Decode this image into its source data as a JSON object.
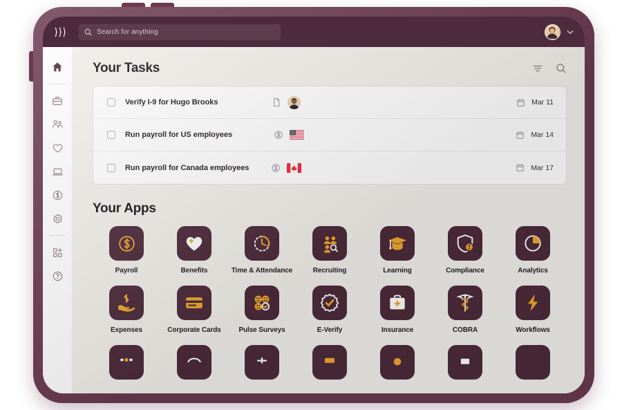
{
  "topbar": {
    "logo_icon": "rippling-wave-logo",
    "search": {
      "icon": "search-icon",
      "placeholder": "Search for anything",
      "value": ""
    },
    "avatar_icon": "user-avatar",
    "chevron_icon": "chevron-down-icon"
  },
  "sidebar": {
    "items": [
      {
        "name": "home",
        "icon": "home-icon",
        "active": true
      },
      {
        "name": "work",
        "icon": "briefcase-icon",
        "active": false
      },
      {
        "name": "people",
        "icon": "people-icon",
        "active": false
      },
      {
        "name": "benefits",
        "icon": "heart-icon",
        "active": false
      },
      {
        "name": "devices",
        "icon": "laptop-icon",
        "active": false
      },
      {
        "name": "finance",
        "icon": "dollar-circle-icon",
        "active": false
      },
      {
        "name": "settings",
        "icon": "gear-icon",
        "active": false
      },
      {
        "name": "add-apps",
        "icon": "add-apps-icon",
        "active": false
      },
      {
        "name": "help",
        "icon": "help-circle-icon",
        "active": false
      }
    ]
  },
  "tasks_section": {
    "title": "Your Tasks",
    "filter_icon": "filter-icon",
    "search_icon": "search-icon",
    "rows": [
      {
        "checked": false,
        "label": "Verify I-9 for Hugo Brooks",
        "type_icon": "document-icon",
        "subject_icon": "person-avatar",
        "date_icon": "calendar-icon",
        "date": "Mar 11"
      },
      {
        "checked": false,
        "label": "Run payroll for US employees",
        "type_icon": "dollar-circle-icon",
        "subject_icon": "flag-us",
        "date_icon": "calendar-icon",
        "date": "Mar 14"
      },
      {
        "checked": false,
        "label": "Run payroll for Canada employees",
        "type_icon": "dollar-circle-icon",
        "subject_icon": "flag-ca",
        "date_icon": "calendar-icon",
        "date": "Mar 17"
      }
    ]
  },
  "apps_section": {
    "title": "Your Apps",
    "apps": [
      {
        "label": "Payroll",
        "icon": "dollar-circle-icon"
      },
      {
        "label": "Benefits",
        "icon": "heart-plus-icon"
      },
      {
        "label": "Time & Attendance",
        "icon": "clock-icon"
      },
      {
        "label": "Recruiting",
        "icon": "people-search-icon"
      },
      {
        "label": "Learning",
        "icon": "graduation-cap-icon"
      },
      {
        "label": "Compliance",
        "icon": "shield-alert-icon"
      },
      {
        "label": "Analytics",
        "icon": "pie-chart-icon"
      },
      {
        "label": "Expenses",
        "icon": "hand-dollar-icon"
      },
      {
        "label": "Corporate Cards",
        "icon": "credit-card-icon"
      },
      {
        "label": "Pulse Surveys",
        "icon": "smiley-grid-icon"
      },
      {
        "label": "E-Verify",
        "icon": "badge-check-icon"
      },
      {
        "label": "Insurance",
        "icon": "medical-kit-icon"
      },
      {
        "label": "COBRA",
        "icon": "caduceus-icon"
      },
      {
        "label": "Workflows",
        "icon": "lightning-bolt-icon"
      }
    ],
    "clipped_row_count": 7
  },
  "colors": {
    "brand_plum": "#4E2B3C",
    "frame_plum": "#6B3A50",
    "accent_amber": "#F0A830",
    "canvas": "#F3F1EC",
    "card": "#FFFFFF"
  }
}
